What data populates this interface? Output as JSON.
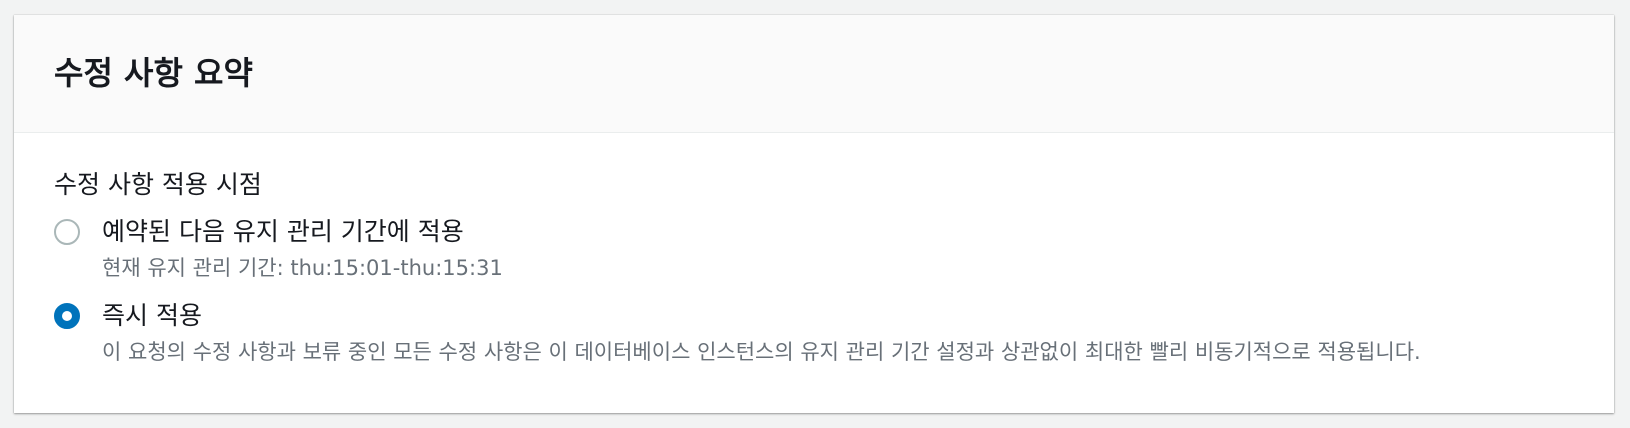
{
  "panel": {
    "title": "수정 사항 요약"
  },
  "schedule": {
    "label": "수정 사항 적용 시점",
    "options": [
      {
        "label": "예약된 다음 유지 관리 기간에 적용",
        "description": "현재 유지 관리 기간: thu:15:01-thu:15:31",
        "selected": false
      },
      {
        "label": "즉시 적용",
        "description": "이 요청의 수정 사항과 보류 중인 모든 수정 사항은 이 데이터베이스 인스턴스의 유지 관리 기간 설정과 상관없이 최대한 빨리 비동기적으로 적용됩니다.",
        "selected": true
      }
    ]
  },
  "colors": {
    "accent": "#0073bb",
    "text_primary": "#16191f",
    "text_secondary": "#687078",
    "header_bg": "#fafafa"
  }
}
